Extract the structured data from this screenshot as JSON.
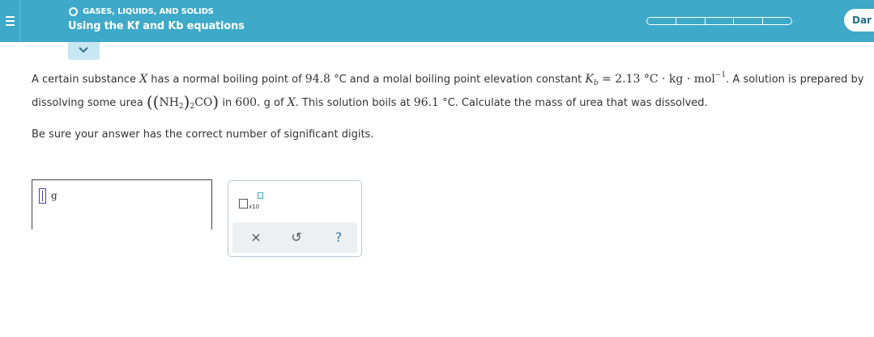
{
  "header": {
    "topic": "GASES, LIQUIDS, AND SOLIDS",
    "title": "Using the Kf and Kb equations",
    "dark_button_label": "Dar",
    "progress_segments": 5,
    "accent_color": "#3ea9c9"
  },
  "question": {
    "line1_prefix": "A certain substance ",
    "substance": "X",
    "line1_mid": " has a normal boiling point of ",
    "boiling_point": "94.8",
    "unit_c1": " °C and a molal boiling point elevation constant ",
    "k_symbol": "K",
    "k_sub": "b",
    "k_equals": " = 2.13 °C · kg · mol",
    "k_exp": "−1",
    "line1_suffix": ". A solution is prepared by",
    "line2_prefix": "dissolving some urea ",
    "urea_nh": "NH",
    "urea_nh_sub": "2",
    "urea_nh_outer_sub": "2",
    "urea_co": "CO",
    "line2_mid": " in ",
    "solvent_mass": "600.",
    "line2_g": " g of ",
    "solvent_x": "X",
    "line2_mid2": ". This solution boils at ",
    "solution_bp": "96.1",
    "line2_suffix": " °C. Calculate the mass of urea that was dissolved.",
    "instruction": "Be sure your answer has the correct number of significant digits."
  },
  "answer": {
    "value": "",
    "unit": "g"
  },
  "tools": {
    "sci_notation_label": "x10",
    "clear_label": "×",
    "undo_label": "↺",
    "help_label": "?"
  },
  "icons": {
    "menu": "hamburger-menu-icon",
    "collapse": "chevron-down-icon",
    "status": "circle-status-icon"
  }
}
